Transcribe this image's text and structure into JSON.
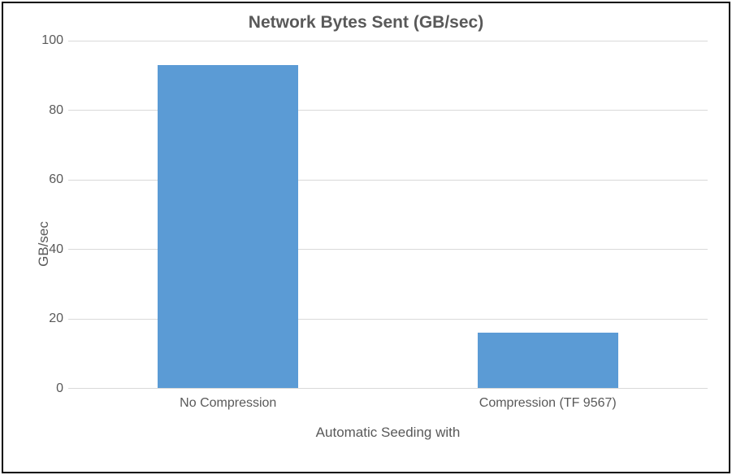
{
  "chart_data": {
    "type": "bar",
    "title": "Network Bytes Sent (GB/sec)",
    "xlabel": "Automatic Seeding with",
    "ylabel": "GB/sec",
    "categories": [
      "No Compression",
      "Compression (TF 9567)"
    ],
    "values": [
      93,
      16
    ],
    "ylim": [
      0,
      100
    ],
    "yticks": [
      0,
      20,
      40,
      60,
      80,
      100
    ]
  },
  "colors": {
    "bar": "#5b9bd5",
    "text": "#595959",
    "grid": "#d9d9d9"
  }
}
